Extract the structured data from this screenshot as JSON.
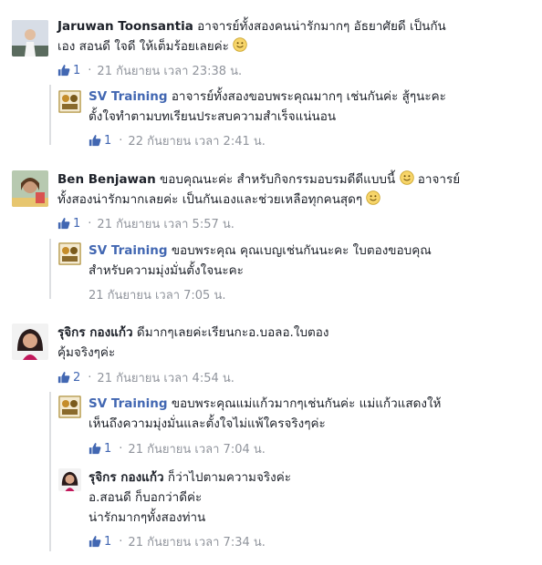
{
  "comments": [
    {
      "author": "Jaruwan Toonsantia",
      "text1": "อาจารย์ทั้งสองคนน่ารักมากๆ อัธยาศัยดี เป็นกัน",
      "text2": "เอง สอนดี ใจดี ให้เต็มร้อยเลยค่ะ",
      "likes": "1",
      "time": "21 กันยายน เวลา 23:38 น.",
      "reply": {
        "author": "SV Training",
        "text1": "อาจารย์ทั้งสองขอบพระคุณมากๆ เช่นกันค่ะ สู้ๆนะคะ",
        "text2": "ตั้งใจทำตามบทเรียนประสบความสำเร็จแน่นอน",
        "likes": "1",
        "time": "22 กันยายน เวลา 2:41 น."
      }
    },
    {
      "author": "Ben Benjawan",
      "text1": "ขอบคุณนะค่ะ สำหรับกิจกรรมอบรมดีดีแบบนี้",
      "text1b": "อาจารย์",
      "text2": "ทั้งสองน่ารักมากเลยค่ะ เป็นกันเองและช่วยเหลือทุกคนสุดๆ",
      "likes": "1",
      "time": "21 กันยายน เวลา 5:57 น.",
      "reply": {
        "author": "SV Training",
        "text1": "ขอบพระคุณ คุณเบญเช่นกันนะคะ ใบตองขอบคุณ",
        "text2": "สำหรับความมุ่งมั่นตั้งใจนะคะ",
        "time": "21 กันยายน เวลา 7:05 น."
      }
    },
    {
      "author": "รุจิกร กองแก้ว",
      "text1": "ดีมากๆเลยค่ะเรียนกะอ.บอลอ.ใบตอง",
      "text2": "คุ้มจริงๆค่ะ",
      "likes": "2",
      "time": "21 กันยายน เวลา 4:54 น.",
      "reply": {
        "author": "SV Training",
        "text1": "ขอบพระคุณแม่แก้วมากๆเช่นกันค่ะ แม่แก้วแสดงให้",
        "text2": "เห็นถึงความมุ่งมั่นและตั้งใจไม่แพ้ใครจริงๆค่ะ",
        "likes": "1",
        "time": "21 กันยายน เวลา 7:04 น."
      },
      "reply2": {
        "author": "รุจิกร กองแก้ว",
        "text1": "ก็ว่าไปตามความจริงค่ะ",
        "text2": "อ.สอนดี ก็บอกว่าดีค่ะ",
        "text3": "น่ารักมากๆทั้งสองท่าน",
        "likes": "1",
        "time": "21 กันยายน เวลา 7:34 น."
      }
    }
  ],
  "icons": {
    "like": "thumbs-up-icon",
    "smile": "smile-emoji-icon"
  },
  "colors": {
    "link": "#4267b2",
    "meta": "#90949c",
    "text": "#1d2129"
  }
}
